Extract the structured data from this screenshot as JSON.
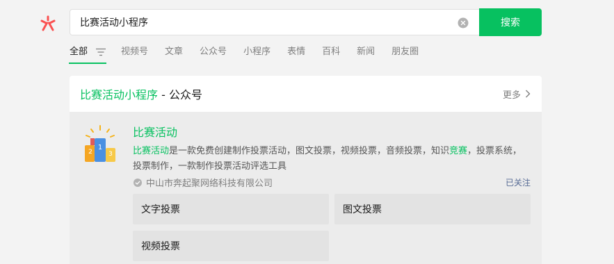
{
  "logo": {
    "icon": "search-logo-icon",
    "color": "#fa5151"
  },
  "search": {
    "query": "比赛活动小程序",
    "placeholder": "",
    "clear_icon": "clear-icon",
    "button_label": "搜索",
    "accent": "#07c160"
  },
  "tabs": {
    "active": "全部",
    "items": [
      "视频号",
      "文章",
      "公众号",
      "小程序",
      "表情",
      "百科",
      "新闻",
      "朋友圈"
    ]
  },
  "result": {
    "title_highlight": "比赛活动小程序",
    "title_suffix": " - 公众号",
    "more_label": "更多",
    "account": {
      "name": "比赛活动",
      "desc_highlight": "比赛活动",
      "desc_part1": "是一款免费创建制作投票活动，图文投票，视频投票，音频投票，知识",
      "desc_highlight2": "竞赛",
      "desc_part2": "，投票系统，投票制作，一款制作投票活动评选工具",
      "company": "中山市奔起聚网络科技有限公司",
      "follow_status": "已关注",
      "services": [
        "文字投票",
        "图文投票",
        "视频投票"
      ]
    }
  }
}
